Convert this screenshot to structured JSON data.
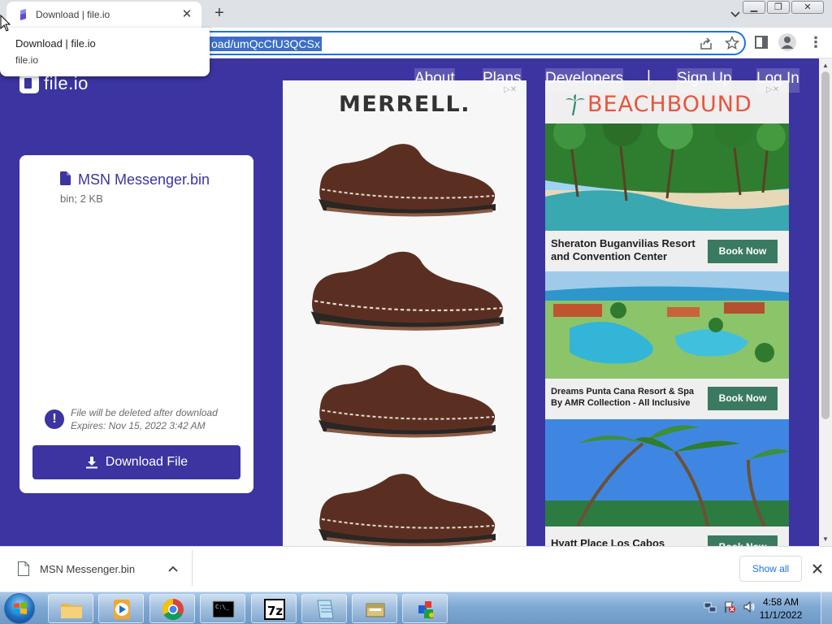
{
  "browser": {
    "tab_title": "Download | file.io",
    "url_visible": "oad/umQcCfU3QCSx",
    "tooltip": {
      "title": "Download | file.io",
      "domain": "file.io"
    }
  },
  "site": {
    "logo_text": "file.io",
    "nav": [
      "About",
      "Plans",
      "Developers",
      "|",
      "Sign Up",
      "Log In"
    ]
  },
  "file_card": {
    "file_name": "MSN Messenger.bin",
    "file_meta": "bin; 2 KB",
    "notice_line1": "File will be deleted after download",
    "notice_line2": "Expires: Nov 15, 2022 3:42 AM",
    "download_label": "Download File"
  },
  "ads": {
    "merrell": {
      "brand": "MERRELL."
    },
    "beachbound": {
      "brand": "BEACHBOUND",
      "hotels": [
        {
          "name": "Sheraton Buganvilias Resort and Convention Center",
          "cta": "Book Now"
        },
        {
          "name": "Dreams Punta Cana Resort & Spa By AMR Collection - All Inclusive",
          "cta": "Book Now"
        },
        {
          "name": "Hyatt Place Los Cabos",
          "cta": "Book Now"
        }
      ]
    }
  },
  "download_shelf": {
    "file_name": "MSN Messenger.bin",
    "show_all": "Show all"
  },
  "taskbar": {
    "time": "4:58 AM",
    "date": "11/1/2022"
  },
  "colors": {
    "brand": "#3b34a1",
    "chrome_accent": "#1a73e8",
    "book_now": "#3a7a61",
    "beachbound": "#e8553d"
  }
}
